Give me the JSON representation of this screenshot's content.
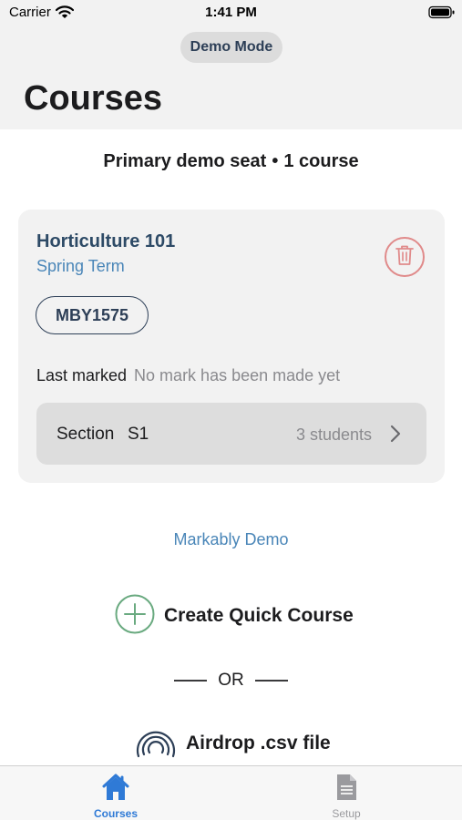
{
  "status_bar": {
    "carrier": "Carrier",
    "time": "1:41 PM"
  },
  "header": {
    "demo_mode_label": "Demo Mode",
    "title": "Courses"
  },
  "summary": {
    "seat": "Primary demo seat",
    "separator": "•",
    "course_count": "1 course"
  },
  "course": {
    "name": "Horticulture 101",
    "term": "Spring Term",
    "code": "MBY1575",
    "last_marked_label": "Last marked",
    "last_marked_value": "No mark has been made yet",
    "section": {
      "label": "Section",
      "id": "S1",
      "students": "3 students"
    }
  },
  "app_link": "Markably Demo",
  "actions": {
    "create_quick_course": "Create Quick Course",
    "or": "OR",
    "airdrop_csv": "Airdrop .csv file"
  },
  "tabs": [
    {
      "label": "Courses",
      "icon": "home-icon",
      "active": true
    },
    {
      "label": "Setup",
      "icon": "document-icon",
      "active": false
    }
  ],
  "colors": {
    "accent": "#2f7ad6",
    "heading": "#2d4a66",
    "link": "#4a86b8",
    "delete": "#e08a8a",
    "add": "#6aaa80"
  }
}
